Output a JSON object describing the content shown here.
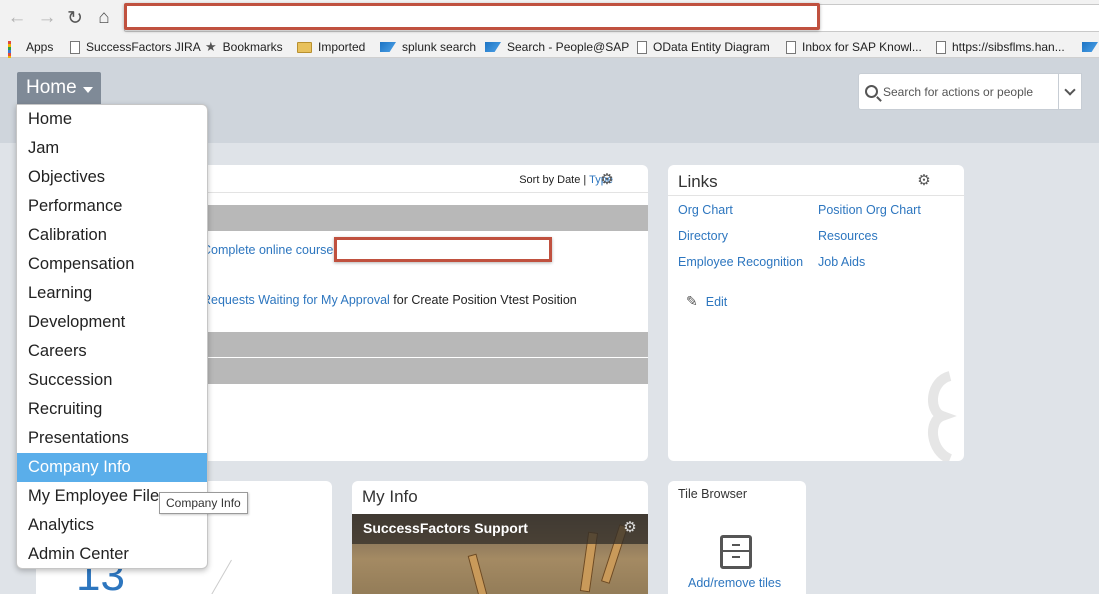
{
  "browser": {
    "bookmarks": [
      {
        "label": "Apps",
        "icon": "apps-icon"
      },
      {
        "label": "SuccessFactors JIRA",
        "icon": "page-icon"
      },
      {
        "label": "Bookmarks",
        "icon": "star-icon"
      },
      {
        "label": "Imported",
        "icon": "folder-icon"
      },
      {
        "label": "splunk search",
        "icon": "sap-icon"
      },
      {
        "label": "Search - People@SAP",
        "icon": "sap-icon"
      },
      {
        "label": "OData Entity Diagram",
        "icon": "page-icon"
      },
      {
        "label": "Inbox for SAP Knowl...",
        "icon": "page-icon"
      },
      {
        "label": "https://sibsflms.han...",
        "icon": "page-icon"
      }
    ]
  },
  "header": {
    "home_label": "Home",
    "search_placeholder": "Search for actions or people"
  },
  "menu": {
    "items": [
      "Home",
      "Jam",
      "Objectives",
      "Performance",
      "Calibration",
      "Compensation",
      "Learning",
      "Development",
      "Careers",
      "Succession",
      "Recruiting",
      "Presentations",
      "Company Info",
      "My Employee File",
      "Analytics",
      "Admin Center"
    ],
    "active": "Company Info",
    "tooltip": "Company Info"
  },
  "todo": {
    "sort_prefix": "Sort by Date |",
    "sort_type": "Type",
    "item1_link": "Complete online course",
    "item2_link": "Requests Waiting for My Approval",
    "item2_text": "for Create Position Vtest Position"
  },
  "links": {
    "title": "Links",
    "items": [
      "Org Chart",
      "Position Org Chart",
      "Directory",
      "Resources",
      "Employee Recognition",
      "Job Aids"
    ],
    "edit_label": "Edit"
  },
  "left_tile": {
    "count": "13"
  },
  "myinfo": {
    "title": "My Info",
    "banner": "SuccessFactors Support"
  },
  "tile_browser": {
    "title": "Tile Browser",
    "action": "Add/remove tiles"
  },
  "colors": {
    "accent": "#2d76bf",
    "menu_active": "#5aaeea",
    "redaction": "#c0513f"
  }
}
